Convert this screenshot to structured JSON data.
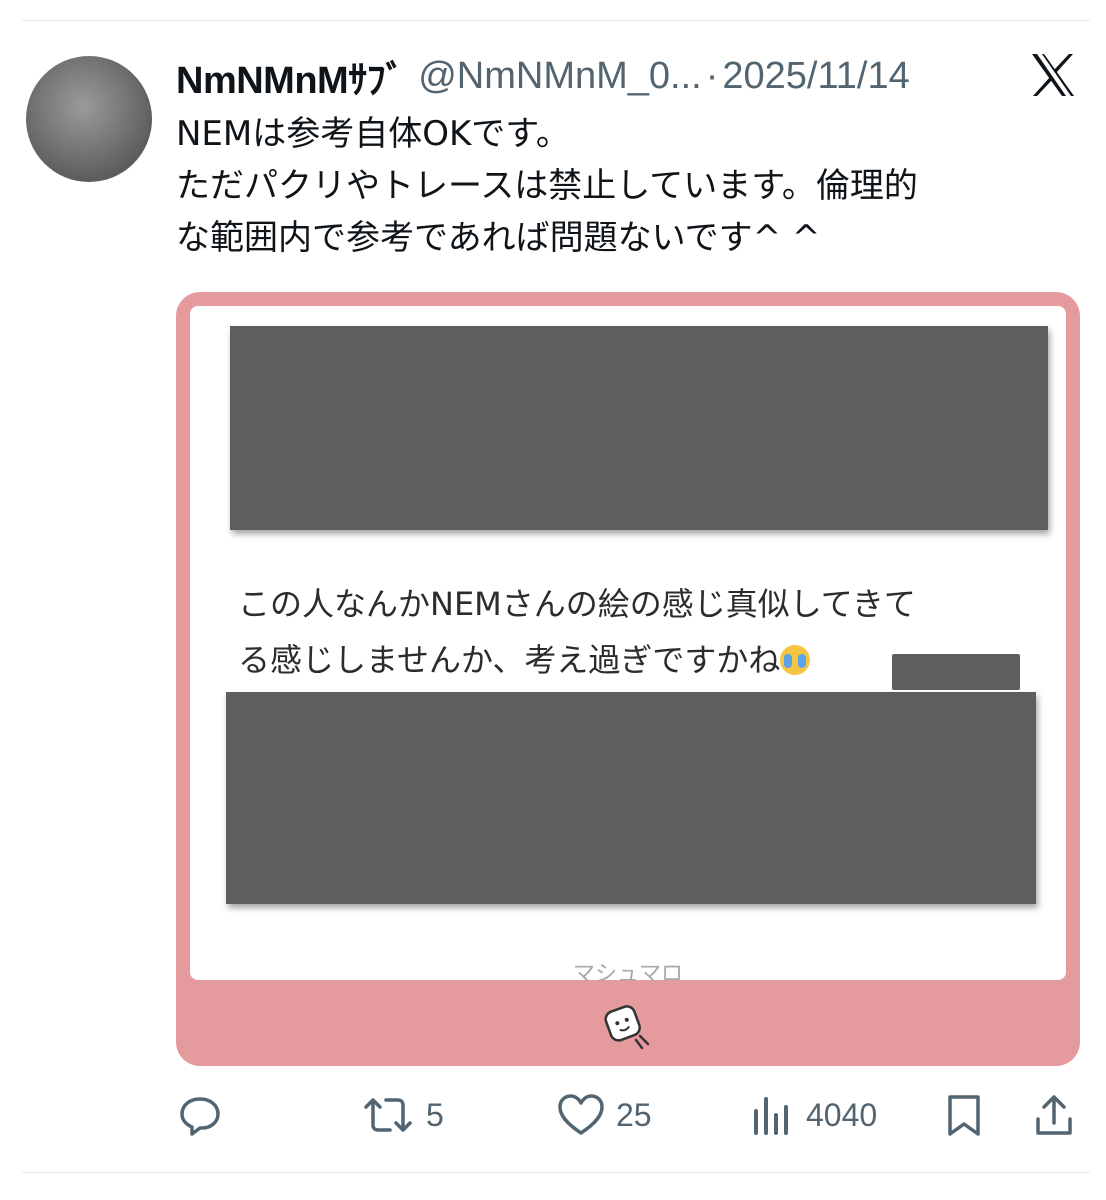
{
  "tweet": {
    "display_name": "NmNMnMｻﾌﾞ",
    "handle": "@NmNMnM_0...",
    "separator": "·",
    "date": "2025/11/14",
    "text_lines": [
      "NEMは参考自体OKです。",
      "ただパクリやトレースは禁止しています。倫理的",
      "な範囲内で参考であれば問題ないです^ ^"
    ]
  },
  "media": {
    "question_lines": [
      "この人なんかNEMさんの絵の感じ真似してきて",
      "る感じしませんか、考え過ぎですかね"
    ],
    "site_label": "マシュマロ",
    "frame_color": "#e59a9e"
  },
  "actions": {
    "reply": {
      "icon": "reply-icon",
      "count": ""
    },
    "retweet": {
      "icon": "retweet-icon",
      "count": "5"
    },
    "like": {
      "icon": "heart-icon",
      "count": "25"
    },
    "views": {
      "icon": "views-icon",
      "count": "4040"
    },
    "bookmark": {
      "icon": "bookmark-icon"
    },
    "share": {
      "icon": "share-icon"
    }
  }
}
